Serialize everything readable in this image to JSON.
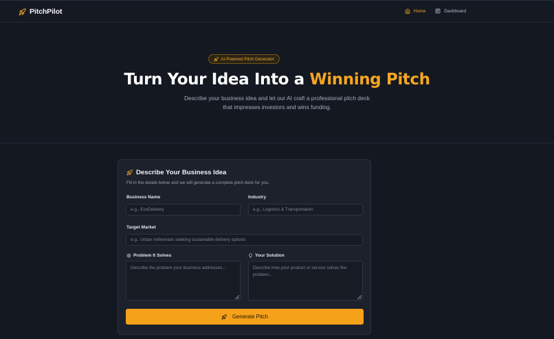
{
  "brand": {
    "name": "PitchPilot",
    "icon": "rocket-icon",
    "accent": "#f5a623"
  },
  "nav": {
    "items": [
      {
        "label": "Home",
        "icon": "home-icon",
        "active": true
      },
      {
        "label": "Dashboard",
        "icon": "dashboard-icon",
        "active": false
      }
    ]
  },
  "hero": {
    "badge": "AI-Powered Pitch Generator",
    "title_main": "Turn Your Idea Into a",
    "title_accent": "Winning Pitch",
    "subtitle_line1": "Describe your business idea and let our AI craft a professional pitch deck",
    "subtitle_line2": "that impresses investors and wins funding."
  },
  "form": {
    "title": "Describe Your Business Idea",
    "subtitle": "Fill in the details below and we will generate a complete pitch deck for you.",
    "business_name": {
      "label": "Business Name",
      "placeholder": "e.g., EcoDelivery",
      "value": ""
    },
    "industry": {
      "label": "Industry",
      "placeholder": "e.g., Logistics & Transportation",
      "value": ""
    },
    "target_market": {
      "label": "Target Market",
      "placeholder": "e.g., Urban millennials seeking sustainable delivery options",
      "value": ""
    },
    "problem": {
      "label": "Problem It Solves",
      "icon": "target-icon",
      "placeholder": "Describe the problem your business addresses...",
      "value": ""
    },
    "solution": {
      "label": "Your Solution",
      "icon": "lightbulb-icon",
      "placeholder": "Describe how your product or service solves the problem...",
      "value": ""
    },
    "submit_label": "Generate Pitch",
    "button_color": "#f5a11a"
  }
}
